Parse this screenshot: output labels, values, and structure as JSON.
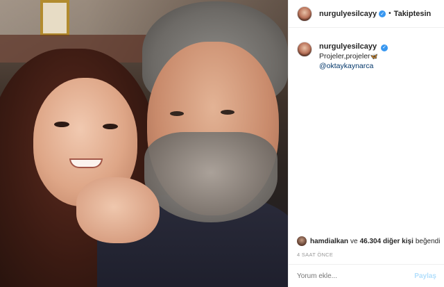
{
  "header": {
    "username": "nurgulyesilcayy",
    "separator": "•",
    "follow_label": "Takiptesin",
    "verified_glyph": "✓"
  },
  "caption": {
    "username": "nurgulyesilcayy",
    "text": "Projeler,projeler",
    "emoji": "🦋",
    "mention": "@oktaykaynarca"
  },
  "likes": {
    "user": "hamdialkan",
    "connector": "ve",
    "count_text": "46.304 diğer kişi",
    "suffix": "beğendi"
  },
  "timestamp": "4 SAAT ÖNCE",
  "comment": {
    "placeholder": "Yorum ekle...",
    "post_label": "Paylaş"
  },
  "colors": {
    "verified": "#3897f0",
    "mention": "#003569",
    "post_button": "#b2dffc"
  }
}
